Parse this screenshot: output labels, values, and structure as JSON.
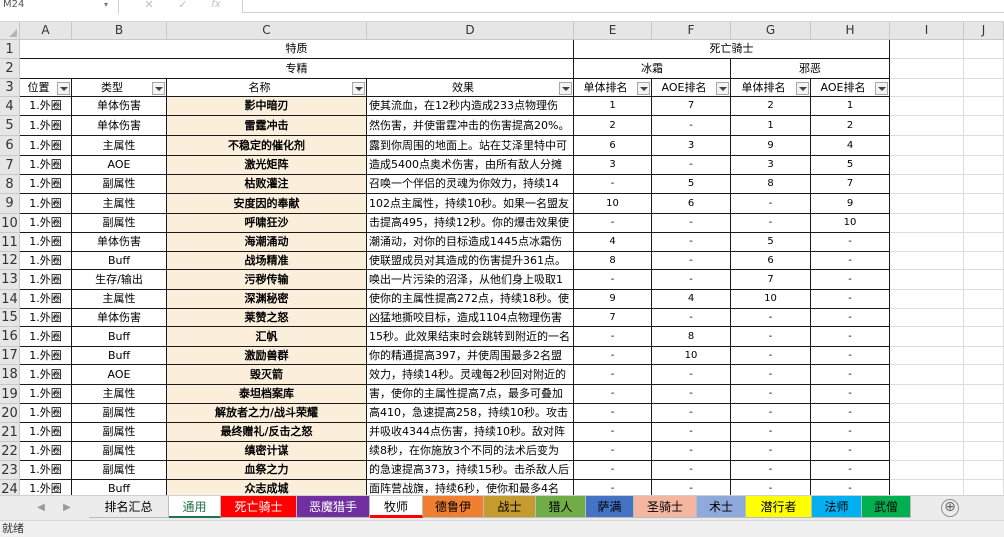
{
  "formula_bar": {
    "name_box": "M24",
    "fx": "fx"
  },
  "columns": [
    "A",
    "B",
    "C",
    "D",
    "E",
    "F",
    "G",
    "H",
    "I",
    "J"
  ],
  "rows": [
    "1",
    "2",
    "3",
    "4",
    "5",
    "6",
    "7",
    "8",
    "9",
    "10",
    "11",
    "12",
    "13",
    "14",
    "15",
    "16",
    "17",
    "18",
    "19",
    "20",
    "21",
    "22",
    "23",
    "24"
  ],
  "header": {
    "trait": "特质",
    "class": "死亡骑士",
    "specialty": "专精",
    "frost": "冰霜",
    "unholy": "邪恶",
    "col_position": "位置",
    "col_type": "类型",
    "col_name": "名称",
    "col_effect": "效果",
    "col_frost_single": "单体排名",
    "col_frost_aoe": "AOE排名",
    "col_unholy_single": "单体排名",
    "col_unholy_aoe": "AOE排名"
  },
  "data_rows": [
    [
      "1.外圈",
      "单体伤害",
      "影中暗刃",
      "使其流血，在12秒内造成233点物理伤",
      "1",
      "7",
      "2",
      "1"
    ],
    [
      "1.外圈",
      "单体伤害",
      "雷霆冲击",
      "然伤害，并使雷霆冲击的伤害提高20%。",
      "2",
      "-",
      "1",
      "2"
    ],
    [
      "1.外圈",
      "主属性",
      "不稳定的催化剂",
      "露到你周围的地面上。站在艾泽里特中可",
      "6",
      "3",
      "9",
      "4"
    ],
    [
      "1.外圈",
      "AOE",
      "激光矩阵",
      "造成5400点奥术伤害，由所有敌人分摊",
      "3",
      "-",
      "3",
      "5"
    ],
    [
      "1.外圈",
      "副属性",
      "枯败灌注",
      "召唤一个伴侣的灵魂为你效力，持续14",
      "-",
      "5",
      "8",
      "7"
    ],
    [
      "1.外圈",
      "主属性",
      "安度因的奉献",
      "102点主属性，持续10秒。如果一名盟友",
      "10",
      "6",
      "-",
      "9"
    ],
    [
      "1.外圈",
      "副属性",
      "呼啸狂沙",
      "击提高495，持续12秒。你的爆击效果使",
      "-",
      "-",
      "-",
      "10"
    ],
    [
      "1.外圈",
      "单体伤害",
      "海潮涌动",
      "潮涌动，对你的目标造成1445点冰霜伤",
      "4",
      "-",
      "5",
      "-"
    ],
    [
      "1.外圈",
      "Buff",
      "战场精准",
      "使联盟成员对其造成的伤害提升361点。",
      "8",
      "-",
      "6",
      "-"
    ],
    [
      "1.外圈",
      "生存/输出",
      "污秽传输",
      "唤出一片污染的沼泽，从他们身上吸取1",
      "-",
      "-",
      "7",
      "-"
    ],
    [
      "1.外圈",
      "主属性",
      "深渊秘密",
      "使你的主属性提高272点，持续18秒。使",
      "9",
      "4",
      "10",
      "-"
    ],
    [
      "1.外圈",
      "单体伤害",
      "莱赞之怒",
      "凶猛地撕咬目标，造成1104点物理伤害",
      "7",
      "-",
      "-",
      "-"
    ],
    [
      "1.外圈",
      "Buff",
      "汇帆",
      "15秒。此效果结束时会跳转到附近的一名",
      "-",
      "8",
      "-",
      "-"
    ],
    [
      "1.外圈",
      "Buff",
      "激励兽群",
      "你的精通提高397，并使周围最多2名盟",
      "-",
      "10",
      "-",
      "-"
    ],
    [
      "1.外圈",
      "AOE",
      "毁灭箭",
      "效力，持续14秒。灵魂每2秒回对附近的",
      "-",
      "-",
      "-",
      "-"
    ],
    [
      "1.外圈",
      "主属性",
      "泰坦档案库",
      "害，使你的主属性提高7点，最多可叠加",
      "-",
      "-",
      "-",
      "-"
    ],
    [
      "1.外圈",
      "副属性",
      "解放者之力/战斗荣耀",
      "高410，急速提高258，持续10秒。攻击",
      "-",
      "-",
      "-",
      "-"
    ],
    [
      "1.外圈",
      "副属性",
      "最终赠礼/反击之怒",
      "并吸收4344点伤害，持续10秒。敌对阵",
      "-",
      "-",
      "-",
      "-"
    ],
    [
      "1.外圈",
      "副属性",
      "缜密计谋",
      "续8秒，在你施放3个不同的法术后变为",
      "-",
      "-",
      "-",
      "-"
    ],
    [
      "1.外圈",
      "副属性",
      "血祭之力",
      "的急速提高373，持续15秒。击杀敌人后",
      "-",
      "-",
      "-",
      "-"
    ],
    [
      "1.外圈",
      "Buff",
      "众志成城",
      "面阵营战旗，持续6秒，使你和最多4名",
      "-",
      "-",
      "-",
      "-"
    ]
  ],
  "sheet_tabs": [
    {
      "label": "排名汇总",
      "color": "#ececec"
    },
    {
      "label": "通用",
      "color": "#ffffff"
    },
    {
      "label": "死亡骑士",
      "color": "#ff0000"
    },
    {
      "label": "恶魔猎手",
      "color": "#7030a0"
    },
    {
      "label": "牧师",
      "color": "#ffffff"
    },
    {
      "label": "德鲁伊",
      "color": "#f08030"
    },
    {
      "label": "战士",
      "color": "#c59a2e"
    },
    {
      "label": "猎人",
      "color": "#70ad47"
    },
    {
      "label": "萨满",
      "color": "#4472c4"
    },
    {
      "label": "圣骑士",
      "color": "#f4b6a0"
    },
    {
      "label": "术士",
      "color": "#8ea9db"
    },
    {
      "label": "潜行者",
      "color": "#ffff00"
    },
    {
      "label": "法师",
      "color": "#00b0f0"
    },
    {
      "label": "武僧",
      "color": "#00b050"
    }
  ],
  "add_sheet": "⊕",
  "status": "就绪"
}
